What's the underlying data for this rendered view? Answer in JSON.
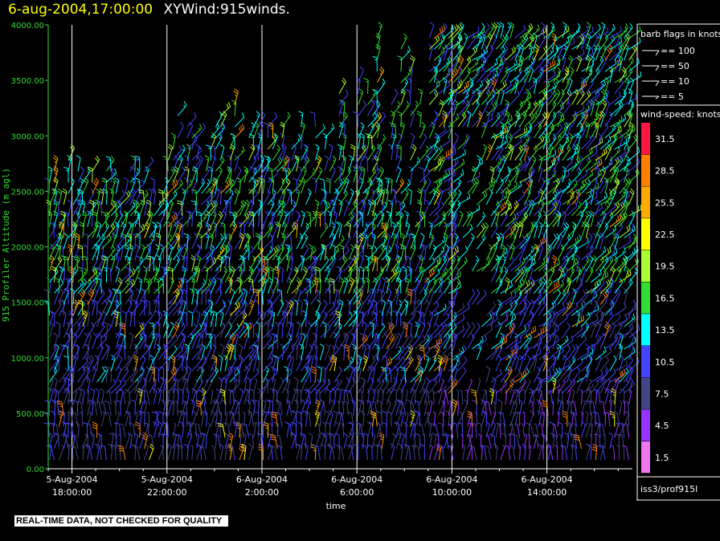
{
  "header": {
    "datetime": "6-aug-2004,17:00:00",
    "product": "XYWind:915winds."
  },
  "colors": {
    "axis": "#33dd33",
    "gridline": "#ffffff",
    "background": "#000000"
  },
  "chart_data": {
    "type": "wind-barb time-height plot",
    "xlabel": "time",
    "ylabel": "915 Profiler Altitude (m agl)",
    "ylim": [
      0,
      4000
    ],
    "yticks": [
      "0.00",
      "500.00",
      "1000.00",
      "1500.00",
      "2000.00",
      "2500.00",
      "3000.00",
      "3500.00",
      "4000.00"
    ],
    "ytick_values": [
      0,
      500,
      1000,
      1500,
      2000,
      2500,
      3000,
      3500,
      4000
    ],
    "xlim_hours": [
      16,
      21.6
    ],
    "xticks": [
      {
        "date": "5-Aug-2004",
        "time": "18:00:00",
        "hour": 18
      },
      {
        "date": "5-Aug-2004",
        "time": "22:00:00",
        "hour": 22
      },
      {
        "date": "6-Aug-2004",
        "time": "2:00:00",
        "hour": 26
      },
      {
        "date": "6-Aug-2004",
        "time": "6:00:00",
        "hour": 30
      },
      {
        "date": "6-Aug-2004",
        "time": "10:00:00",
        "hour": 34
      },
      {
        "date": "6-Aug-2004",
        "time": "14:00:00",
        "hour": 38
      }
    ],
    "x_range_hours": [
      17.0,
      41.6
    ],
    "vertical_gridlines": true,
    "speed_scale": {
      "title": "wind-speed: knots",
      "levels": [
        {
          "label": "31.5",
          "color": "#ff1744"
        },
        {
          "label": "28.5",
          "color": "#ff8000"
        },
        {
          "label": "25.5",
          "color": "#ffaa00"
        },
        {
          "label": "22.5",
          "color": "#ffff00"
        },
        {
          "label": "19.5",
          "color": "#aaff33"
        },
        {
          "label": "16.5",
          "color": "#33dd33"
        },
        {
          "label": "13.5",
          "color": "#00ffff"
        },
        {
          "label": "10.5",
          "color": "#4444ff"
        },
        {
          "label": "7.5",
          "color": "#444488"
        },
        {
          "label": "4.5",
          "color": "#9933ff"
        },
        {
          "label": "1.5",
          "color": "#ee77ee"
        }
      ]
    },
    "barb_key": {
      "title": "barb flags in knots",
      "items": [
        "== 100",
        "== 50",
        "== 10",
        "== 5"
      ]
    }
  },
  "footer": {
    "source": "iss3/prof915l",
    "notice": "REAL-TIME DATA, NOT CHECKED FOR QUALITY"
  }
}
